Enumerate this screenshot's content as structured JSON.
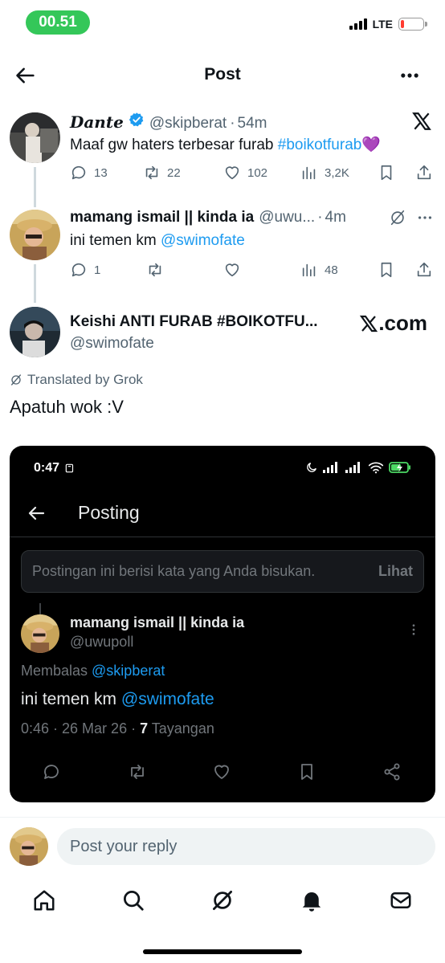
{
  "status_bar": {
    "time": "00.51",
    "network": "LTE"
  },
  "header": {
    "title": "Post"
  },
  "posts": [
    {
      "name": "Dante",
      "handle": "@skipberat",
      "time": "54m",
      "text_plain": "Maaf gw haters terbesar furab ",
      "hashtag": "#boikotfurab",
      "emoji": "💜",
      "replies": "13",
      "reposts": "22",
      "likes": "102",
      "views": "3,2K"
    },
    {
      "name": "mamang ismail || kinda ia",
      "handle": "@uwu...",
      "time": "4m",
      "text_plain": "ini temen km ",
      "mention": "@swimofate",
      "replies": "1",
      "views": "48"
    }
  ],
  "main_post": {
    "name": "Keishi ANTI FURAB #BOIKOTFU...",
    "handle": "@swimofate",
    "source": ".com",
    "translated_label": "Translated by Grok",
    "text": "Apatuh wok :V"
  },
  "embed": {
    "time": "0:47",
    "title": "Posting",
    "muted_notice": "Postingan ini berisi kata yang Anda bisukan.",
    "muted_action": "Lihat",
    "name": "mamang ismail || kinda ia",
    "handle": "@uwupoll",
    "reply_prefix": "Membalas ",
    "reply_to": "@skipberat",
    "text_plain": "ini temen km ",
    "mention": "@swimofate",
    "meta_prefix": "0:46 · 26 Mar 26 · ",
    "views_count": "7",
    "views_label": " Tayangan"
  },
  "reply_bar": {
    "placeholder": "Post your reply"
  },
  "colors": {
    "accent": "#1d9bf0",
    "status_pill": "#34c759",
    "battery_low": "#ff3b30"
  }
}
